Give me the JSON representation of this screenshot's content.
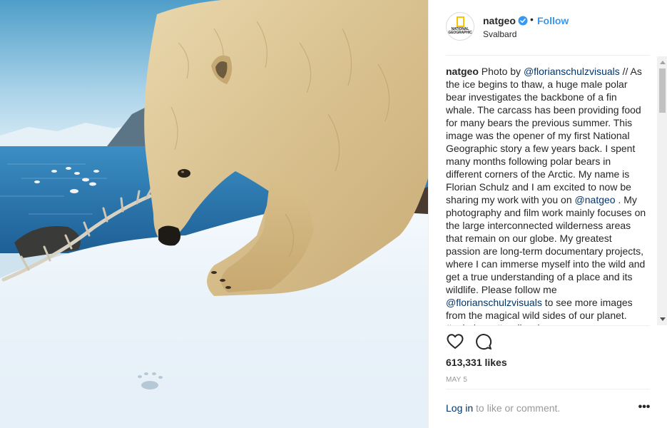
{
  "post": {
    "author": {
      "username": "natgeo",
      "verified": true,
      "follow_label": "Follow",
      "separator": "•",
      "location": "Svalbard",
      "avatar_logo_text": "NATIONAL GEOGRAPHIC"
    },
    "caption": {
      "username": "natgeo",
      "text_1": " Photo by ",
      "mention_1": "@florianschulzvisuals",
      "text_2": " // As the ice begins to thaw, a huge male polar bear investigates the backbone of a fin whale. The carcass has been providing food for many bears the previous summer. This image was the opener of my first National Geographic story a few years back. I spent many months following polar bears in different corners of the Arctic. My name is Florian Schulz and I am excited to now be sharing my work with you on ",
      "mention_2": "@natgeo",
      "text_3": " . My photography and film work mainly focuses on the large interconnected wilderness areas that remain on our globe. My greatest passion are long-term documentary projects, where I can immerse myself into the wild and get a true understanding of a place and its wildlife. Please follow me ",
      "mention_3": "@florianschulzvisuals",
      "text_4": " to see more images from the magical wild sides of our planet. #polarbear #svalbard"
    },
    "likes": "613,331 likes",
    "date": "MAY 5",
    "footer": {
      "login_label": "Log in",
      "rest": " to like or comment."
    },
    "more_label": "•••",
    "icons": {
      "like": "heart-outline-icon",
      "comment": "comment-bubble-icon",
      "more": "more-options-icon",
      "verified": "verified-badge-icon"
    },
    "colors": {
      "accent": "#3897f0",
      "link": "#003569",
      "muted": "#999999"
    }
  }
}
